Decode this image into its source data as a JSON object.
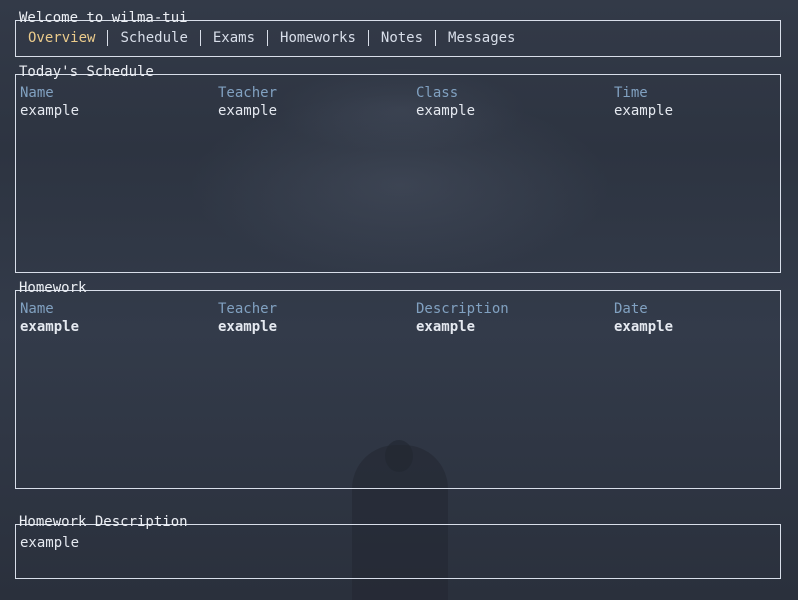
{
  "header": {
    "title": "Welcome to wilma-tui",
    "tabs": [
      {
        "label": "Overview",
        "active": true
      },
      {
        "label": "Schedule",
        "active": false
      },
      {
        "label": "Exams",
        "active": false
      },
      {
        "label": "Homeworks",
        "active": false
      },
      {
        "label": "Notes",
        "active": false
      },
      {
        "label": "Messages",
        "active": false
      }
    ]
  },
  "schedule": {
    "title": "Today's Schedule",
    "columns": [
      "Name",
      "Teacher",
      "Class",
      "Time"
    ],
    "rows": [
      [
        "example",
        "example",
        "example",
        "example"
      ]
    ]
  },
  "homework": {
    "title": "Homework",
    "columns": [
      "Name",
      "Teacher",
      "Description",
      "Date"
    ],
    "rows": [
      [
        "example",
        "example",
        "example",
        "example"
      ]
    ]
  },
  "homework_description": {
    "title": "Homework Description",
    "text": "example"
  },
  "colors": {
    "background": "#2f3542",
    "border": "#d8dee9",
    "active_tab": "#ebcb8b",
    "column_header": "#81a1c1"
  }
}
